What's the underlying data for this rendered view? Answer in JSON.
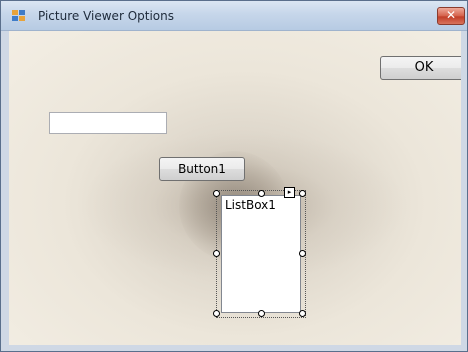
{
  "window": {
    "title": "Picture Viewer Options",
    "close_glyph": "✕"
  },
  "form": {
    "ok_button": "OK",
    "button1": "Button1",
    "textbox": {
      "value": ""
    },
    "listbox": {
      "label": "ListBox1"
    },
    "smart_tag_glyph": "▸"
  },
  "icons": [
    "app-icon",
    "close-icon",
    "smart-tag-icon"
  ]
}
